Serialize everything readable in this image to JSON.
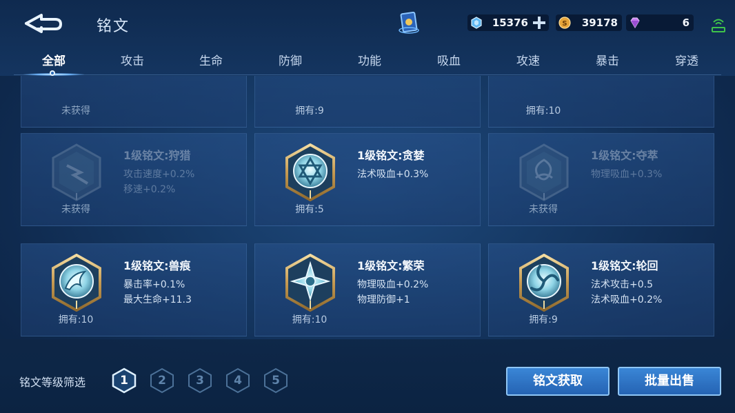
{
  "header": {
    "title": "铭文"
  },
  "resources": {
    "coupons": "15376",
    "gold": "39178",
    "diamonds": "6"
  },
  "tabs": [
    {
      "label": "全部",
      "active": true
    },
    {
      "label": "攻击"
    },
    {
      "label": "生命"
    },
    {
      "label": "防御"
    },
    {
      "label": "功能"
    },
    {
      "label": "吸血"
    },
    {
      "label": "攻速"
    },
    {
      "label": "暴击"
    },
    {
      "label": "穿透"
    }
  ],
  "cards": [
    {
      "own": "未获得",
      "owned": false
    },
    {
      "own": "拥有:9",
      "owned": true
    },
    {
      "own": "拥有:10",
      "owned": true
    },
    {
      "name": "1级铭文:狩猎",
      "stats": [
        "攻击速度+0.2%",
        "移速+0.2%"
      ],
      "own": "未获得",
      "owned": false,
      "icon": "lightning-hex-icon"
    },
    {
      "name": "1级铭文:贪婪",
      "stats": [
        "法术吸血+0.3%"
      ],
      "own": "拥有:5",
      "owned": true,
      "icon": "star-of-david-hex-icon"
    },
    {
      "name": "1级铭文:夺萃",
      "stats": [
        "物理吸血+0.3%"
      ],
      "own": "未获得",
      "owned": false,
      "icon": "knot-hex-icon"
    },
    {
      "name": "1级铭文:兽痕",
      "stats": [
        "暴击率+0.1%",
        "最大生命+11.3"
      ],
      "own": "拥有:10",
      "owned": true,
      "icon": "claw-hex-icon"
    },
    {
      "name": "1级铭文:繁荣",
      "stats": [
        "物理吸血+0.2%",
        "物理防御+1"
      ],
      "own": "拥有:10",
      "owned": true,
      "icon": "cross-star-hex-icon"
    },
    {
      "name": "1级铭文:轮回",
      "stats": [
        "法术攻击+0.5",
        "法术吸血+0.2%"
      ],
      "own": "拥有:9",
      "owned": true,
      "icon": "swirl-hex-icon"
    }
  ],
  "filter": {
    "label": "铭文等级筛选",
    "levels": [
      "1",
      "2",
      "3",
      "4",
      "5"
    ],
    "selected": "1"
  },
  "buttons": {
    "obtain": "铭文获取",
    "sell": "批量出售"
  },
  "colors": {
    "accent": "#2f78c8",
    "gold_frame": "#c9a15a",
    "gem_core": "#9fe3f0"
  }
}
